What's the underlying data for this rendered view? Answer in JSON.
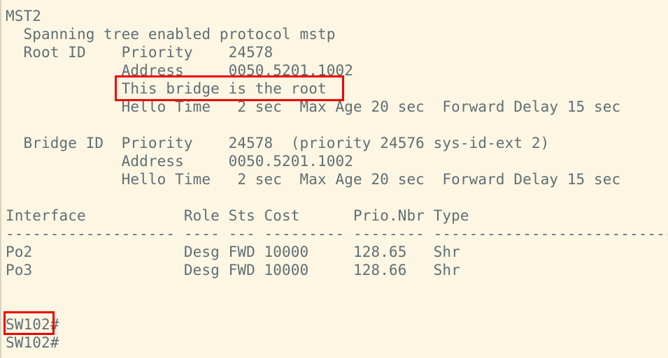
{
  "terminal": {
    "lines": [
      "MST2",
      "  Spanning tree enabled protocol mstp",
      "  Root ID    Priority    24578",
      "             Address     0050.5201.1002",
      "             This bridge is the root",
      "             Hello Time   2 sec  Max Age 20 sec  Forward Delay 15 sec",
      "",
      "  Bridge ID  Priority    24578  (priority 24576 sys-id-ext 2)",
      "             Address     0050.5201.1002",
      "             Hello Time   2 sec  Max Age 20 sec  Forward Delay 15 sec",
      "",
      "Interface           Role Sts Cost      Prio.Nbr Type",
      "------------------- ---- --- --------- -------- --------------------------------",
      "Po2                 Desg FWD 10000     128.65   Shr",
      "Po3                 Desg FWD 10000     128.66   Shr",
      "",
      "",
      "SW102#",
      "SW102#"
    ]
  },
  "highlights": {
    "color": "#ee0000",
    "items": [
      {
        "label": "root-bridge-highlight",
        "text": "This bridge is the root"
      },
      {
        "label": "prompt-highlight",
        "text": "SW102"
      }
    ]
  },
  "colors": {
    "background": "#fdf6e3",
    "text": "#5f6f75"
  }
}
